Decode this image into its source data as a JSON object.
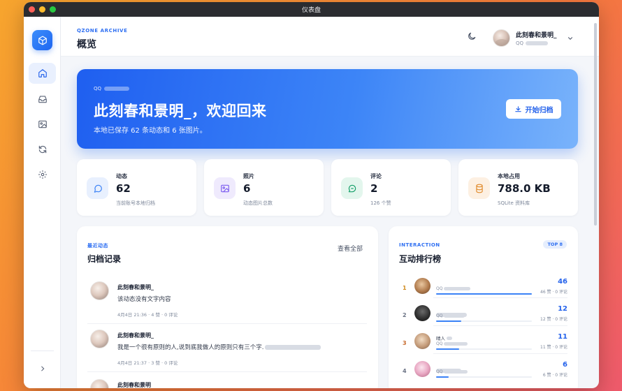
{
  "window": {
    "title": "仪表盘"
  },
  "header": {
    "eyebrow": "QZONE ARCHIVE",
    "title": "概览",
    "user": {
      "name": "此刻春和景明_",
      "qq_label": "QQ"
    }
  },
  "hero": {
    "qq_label": "QQ",
    "title": "此刻春和景明_，欢迎回来",
    "subtitle": "本地已保存 62 条动态和 6 张图片。",
    "button_label": "开始归档"
  },
  "stats": [
    {
      "label": "动态",
      "value": "62",
      "desc": "当前账号本地归档",
      "icon": "chat-bubble-icon",
      "color": "#3b82f6",
      "bg": "#e8f0fe"
    },
    {
      "label": "照片",
      "value": "6",
      "desc": "动态图片总数",
      "icon": "image-icon",
      "color": "#7c5cf0",
      "bg": "#efeafd"
    },
    {
      "label": "评论",
      "value": "2",
      "desc": "126 个赞",
      "icon": "comment-icon",
      "color": "#16a06a",
      "bg": "#e3f6ed"
    },
    {
      "label": "本地占用",
      "value": "788.0 KB",
      "desc": "SQLite 资料库",
      "icon": "database-icon",
      "color": "#e08a2a",
      "bg": "#fdf0e2"
    }
  ],
  "recent": {
    "eyebrow": "最近动态",
    "title": "归档记录",
    "view_all": "查看全部",
    "posts": [
      {
        "name": "此刻春和景明_",
        "text": "该动态没有文字内容",
        "meta": "4月4日 21:36 · 4 赞 · 0 评论"
      },
      {
        "name": "此刻春和景明_",
        "text": "我是一个很有原则的人,说到底我做人的原则只有三个字.",
        "meta": "4月4日 21:37 · 3 赞 · 0 评论"
      },
      {
        "name": "此刻春和景明"
      }
    ]
  },
  "ranking": {
    "eyebrow": "INTERACTION",
    "title": "互动排行榜",
    "badge": "TOP 8",
    "qq_label": "QQ",
    "rows": [
      {
        "rank": "1",
        "score": "46",
        "sub": "46 赞 · 0 评论",
        "share": 1.0
      },
      {
        "rank": "2",
        "score": "12",
        "sub": "12 赞 · 0 评论",
        "share": 0.26
      },
      {
        "rank": "3",
        "name": "晴人",
        "score": "11",
        "sub": "11 赞 · 0 评论",
        "share": 0.24
      },
      {
        "rank": "4",
        "score": "6",
        "sub": "6 赞 · 0 评论",
        "share": 0.13
      }
    ]
  }
}
